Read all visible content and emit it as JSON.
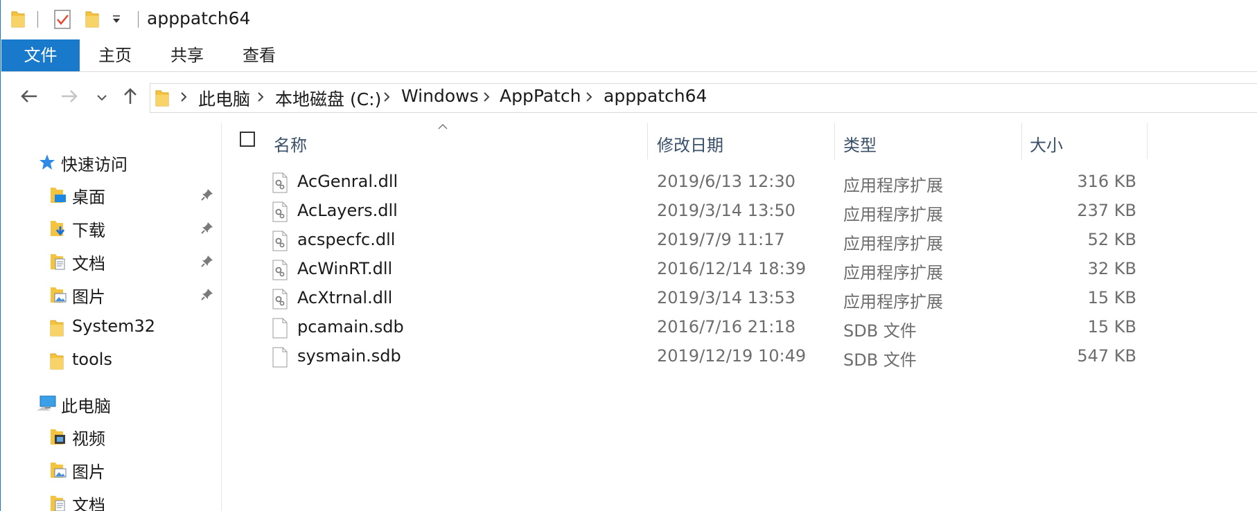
{
  "window": {
    "title": "apppatch64"
  },
  "ribbon": {
    "tabs": [
      {
        "label": "文件"
      },
      {
        "label": "主页"
      },
      {
        "label": "共享"
      },
      {
        "label": "查看"
      }
    ]
  },
  "address": {
    "breadcrumbs": [
      {
        "label": "此电脑"
      },
      {
        "label": "本地磁盘 (C:)"
      },
      {
        "label": "Windows"
      },
      {
        "label": "AppPatch"
      },
      {
        "label": "apppatch64"
      }
    ]
  },
  "sidebar": {
    "quick_access": {
      "label": "快速访问"
    },
    "quick_items": [
      {
        "label": "桌面",
        "icon": "desktop-folder-icon",
        "pinned": true
      },
      {
        "label": "下载",
        "icon": "downloads-folder-icon",
        "pinned": true
      },
      {
        "label": "文档",
        "icon": "documents-folder-icon",
        "pinned": true
      },
      {
        "label": "图片",
        "icon": "pictures-folder-icon",
        "pinned": true
      },
      {
        "label": "System32",
        "icon": "folder-icon",
        "pinned": false
      },
      {
        "label": "tools",
        "icon": "folder-icon",
        "pinned": false
      }
    ],
    "this_pc": {
      "label": "此电脑"
    },
    "pc_items": [
      {
        "label": "视频",
        "icon": "videos-folder-icon"
      },
      {
        "label": "图片",
        "icon": "pictures-folder-icon"
      },
      {
        "label": "文档",
        "icon": "documents-folder-icon"
      }
    ]
  },
  "file_list": {
    "columns": {
      "name": "名称",
      "date": "修改日期",
      "type": "类型",
      "size": "大小"
    },
    "rows": [
      {
        "name": "AcGenral.dll",
        "date": "2019/6/13 12:30",
        "type": "应用程序扩展",
        "size": "316 KB",
        "icon": "dll-file-icon"
      },
      {
        "name": "AcLayers.dll",
        "date": "2019/3/14 13:50",
        "type": "应用程序扩展",
        "size": "237 KB",
        "icon": "dll-file-icon"
      },
      {
        "name": "acspecfc.dll",
        "date": "2019/7/9 11:17",
        "type": "应用程序扩展",
        "size": "52 KB",
        "icon": "dll-file-icon"
      },
      {
        "name": "AcWinRT.dll",
        "date": "2016/12/14 18:39",
        "type": "应用程序扩展",
        "size": "32 KB",
        "icon": "dll-file-icon"
      },
      {
        "name": "AcXtrnal.dll",
        "date": "2019/3/14 13:53",
        "type": "应用程序扩展",
        "size": "15 KB",
        "icon": "dll-file-icon"
      },
      {
        "name": "pcamain.sdb",
        "date": "2016/7/16 21:18",
        "type": "SDB 文件",
        "size": "15 KB",
        "icon": "blank-file-icon"
      },
      {
        "name": "sysmain.sdb",
        "date": "2019/12/19 10:49",
        "type": "SDB 文件",
        "size": "547 KB",
        "icon": "blank-file-icon"
      }
    ]
  },
  "colors": {
    "accent": "#1979ca",
    "folder": "#f4c33f",
    "header_text": "#3a4f6a",
    "secondary_text": "#6d6d6d"
  }
}
